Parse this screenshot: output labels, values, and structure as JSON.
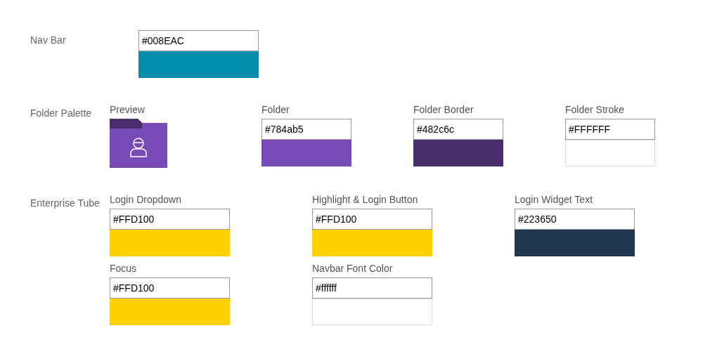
{
  "sections": [
    {
      "label": "Nav Bar",
      "items": [
        {
          "kind": "swatch",
          "value": "#008EAC"
        }
      ]
    },
    {
      "label": "Folder Palette",
      "items": [
        {
          "kind": "preview",
          "label": "Preview"
        },
        {
          "kind": "fill",
          "label": "Folder",
          "value": "#784ab5"
        },
        {
          "kind": "border",
          "label": "Folder Border",
          "value": "#482c6c"
        },
        {
          "kind": "stroke",
          "label": "Folder Stroke",
          "value": "#FFFFFF"
        }
      ]
    },
    {
      "label": "Enterprise Tube",
      "items": [
        {
          "kind": "swatch",
          "label": "Login Dropdown",
          "value": "#FFD100"
        },
        {
          "kind": "swatch",
          "label": "Highlight & Login Button",
          "value": "#FFD100"
        },
        {
          "kind": "swatch",
          "label": "Login Widget Text",
          "value": "#223650"
        },
        {
          "kind": "swatch",
          "label": "Focus",
          "value": "#FFD100"
        },
        {
          "kind": "swatch",
          "label": "Navbar Font Color",
          "value": "#ffffff"
        }
      ]
    }
  ]
}
